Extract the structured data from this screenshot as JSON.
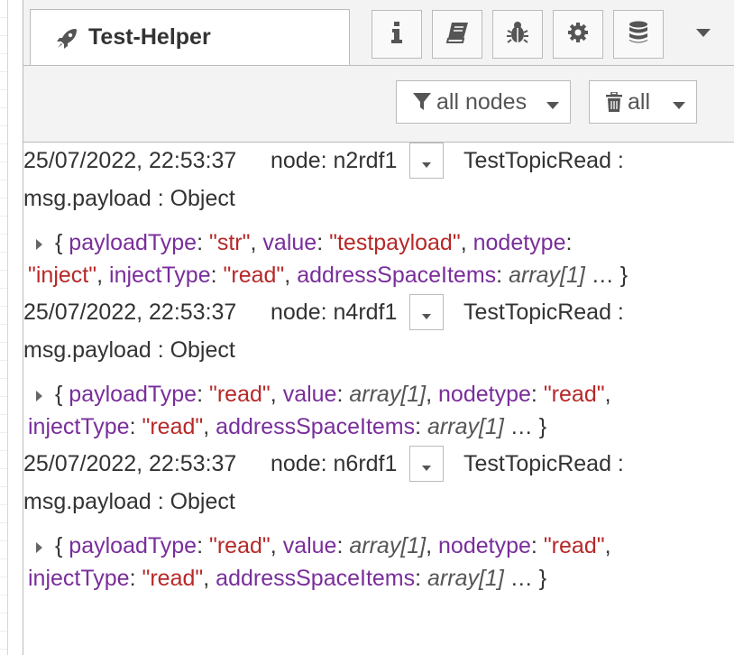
{
  "panel": {
    "tab_title": "Test-Helper",
    "tab_icon": "rocket-icon",
    "buttons": [
      {
        "name": "info-icon"
      },
      {
        "name": "book-icon"
      },
      {
        "name": "bug-icon"
      },
      {
        "name": "gear-icon"
      },
      {
        "name": "database-icon"
      },
      {
        "name": "chevron-down-icon"
      }
    ]
  },
  "filters": {
    "nodes_label": "all nodes",
    "clear_label": "all"
  },
  "messages": [
    {
      "timestamp": "25/07/2022, 22:53:37",
      "node": "node: n2rdf1",
      "topic": "TestTopicRead :",
      "payload_label": "msg.payload : Object",
      "line1": [
        {
          "t": "{ ",
          "c": "p"
        },
        {
          "t": "payloadType",
          "c": "k"
        },
        {
          "t": ": ",
          "c": "p"
        },
        {
          "t": "\"str\"",
          "c": "s"
        },
        {
          "t": ", ",
          "c": "p"
        },
        {
          "t": "value",
          "c": "k"
        },
        {
          "t": ": ",
          "c": "p"
        },
        {
          "t": "\"testpayload\"",
          "c": "s"
        },
        {
          "t": ", ",
          "c": "p"
        },
        {
          "t": "nodetype",
          "c": "k"
        },
        {
          "t": ":",
          "c": "p"
        }
      ],
      "line2": [
        {
          "t": "\"inject\"",
          "c": "s"
        },
        {
          "t": ", ",
          "c": "p"
        },
        {
          "t": "injectType",
          "c": "k"
        },
        {
          "t": ": ",
          "c": "p"
        },
        {
          "t": "\"read\"",
          "c": "s"
        },
        {
          "t": ", ",
          "c": "p"
        },
        {
          "t": "addressSpaceItems",
          "c": "k"
        },
        {
          "t": ": ",
          "c": "p"
        },
        {
          "t": "array[1]",
          "c": "i"
        },
        {
          "t": " … }",
          "c": "p"
        }
      ]
    },
    {
      "timestamp": "25/07/2022, 22:53:37",
      "node": "node: n4rdf1",
      "topic": "TestTopicRead :",
      "payload_label": "msg.payload : Object",
      "line1": [
        {
          "t": "{ ",
          "c": "p"
        },
        {
          "t": "payloadType",
          "c": "k"
        },
        {
          "t": ": ",
          "c": "p"
        },
        {
          "t": "\"read\"",
          "c": "s"
        },
        {
          "t": ", ",
          "c": "p"
        },
        {
          "t": "value",
          "c": "k"
        },
        {
          "t": ": ",
          "c": "p"
        },
        {
          "t": "array[1]",
          "c": "i"
        },
        {
          "t": ", ",
          "c": "p"
        },
        {
          "t": "nodetype",
          "c": "k"
        },
        {
          "t": ": ",
          "c": "p"
        },
        {
          "t": "\"read\"",
          "c": "s"
        },
        {
          "t": ",",
          "c": "p"
        }
      ],
      "line2": [
        {
          "t": "injectType",
          "c": "k"
        },
        {
          "t": ": ",
          "c": "p"
        },
        {
          "t": "\"read\"",
          "c": "s"
        },
        {
          "t": ", ",
          "c": "p"
        },
        {
          "t": "addressSpaceItems",
          "c": "k"
        },
        {
          "t": ": ",
          "c": "p"
        },
        {
          "t": "array[1]",
          "c": "i"
        },
        {
          "t": " … }",
          "c": "p"
        }
      ]
    },
    {
      "timestamp": "25/07/2022, 22:53:37",
      "node": "node: n6rdf1",
      "topic": "TestTopicRead :",
      "payload_label": "msg.payload : Object",
      "line1": [
        {
          "t": "{ ",
          "c": "p"
        },
        {
          "t": "payloadType",
          "c": "k"
        },
        {
          "t": ": ",
          "c": "p"
        },
        {
          "t": "\"read\"",
          "c": "s"
        },
        {
          "t": ", ",
          "c": "p"
        },
        {
          "t": "value",
          "c": "k"
        },
        {
          "t": ": ",
          "c": "p"
        },
        {
          "t": "array[1]",
          "c": "i"
        },
        {
          "t": ", ",
          "c": "p"
        },
        {
          "t": "nodetype",
          "c": "k"
        },
        {
          "t": ": ",
          "c": "p"
        },
        {
          "t": "\"read\"",
          "c": "s"
        },
        {
          "t": ",",
          "c": "p"
        }
      ],
      "line2": [
        {
          "t": "injectType",
          "c": "k"
        },
        {
          "t": ": ",
          "c": "p"
        },
        {
          "t": "\"read\"",
          "c": "s"
        },
        {
          "t": ", ",
          "c": "p"
        },
        {
          "t": "addressSpaceItems",
          "c": "k"
        },
        {
          "t": ": ",
          "c": "p"
        },
        {
          "t": "array[1]",
          "c": "i"
        },
        {
          "t": " … }",
          "c": "p"
        }
      ]
    }
  ],
  "colors": {
    "key": "#792e9b",
    "string": "#b72828",
    "chrome": "#f3f3f3",
    "border": "#bbbbbb"
  }
}
